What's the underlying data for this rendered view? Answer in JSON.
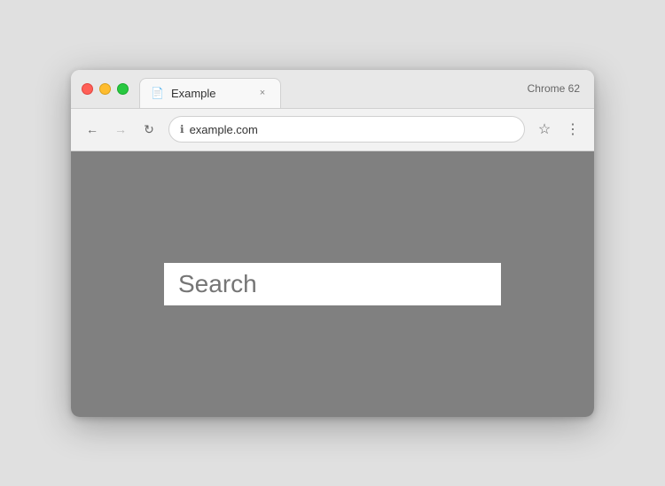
{
  "browser": {
    "chrome_version": "Chrome 62",
    "tab": {
      "title": "Example",
      "icon": "📄",
      "close_label": "×"
    },
    "address_bar": {
      "url": "example.com",
      "secure_icon": "ℹ",
      "back_label": "←",
      "forward_label": "→",
      "reload_label": "↻",
      "bookmark_label": "☆",
      "menu_label": "⋮"
    }
  },
  "page": {
    "search_placeholder": "Search"
  }
}
